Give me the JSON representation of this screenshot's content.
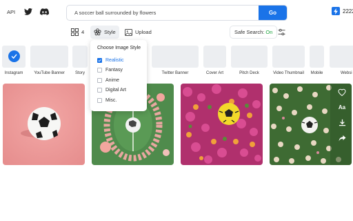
{
  "header": {
    "api_label": "API",
    "search_value": "A soccer ball surrounded by flowers",
    "go_label": "Go",
    "credits": "2222"
  },
  "toolbar": {
    "grid_count": "4",
    "style_label": "Style",
    "upload_label": "Upload",
    "safe_search_label": "Safe Search:",
    "safe_search_value": "On"
  },
  "formats": [
    {
      "label": "Instagram",
      "selected": true
    },
    {
      "label": "YouTube Banner"
    },
    {
      "label": "Story"
    },
    {
      "label": "Twitter Banner"
    },
    {
      "label": "Cover Art"
    },
    {
      "label": "Pitch Deck"
    },
    {
      "label": "Video Thumbnail"
    },
    {
      "label": "Mobile"
    },
    {
      "label": "Websi"
    }
  ],
  "style_menu": {
    "title": "Choose Image Style",
    "options": [
      {
        "label": "Realistic",
        "checked": true
      },
      {
        "label": "Fantasy",
        "checked": false
      },
      {
        "label": "Anime",
        "checked": false
      },
      {
        "label": "Digital Art",
        "checked": false
      },
      {
        "label": "Misc.",
        "checked": false
      }
    ]
  },
  "image_actions": {
    "font_label": "Aa"
  },
  "colors": {
    "accent": "#1a73e8",
    "safe_on": "#1aa33b"
  }
}
